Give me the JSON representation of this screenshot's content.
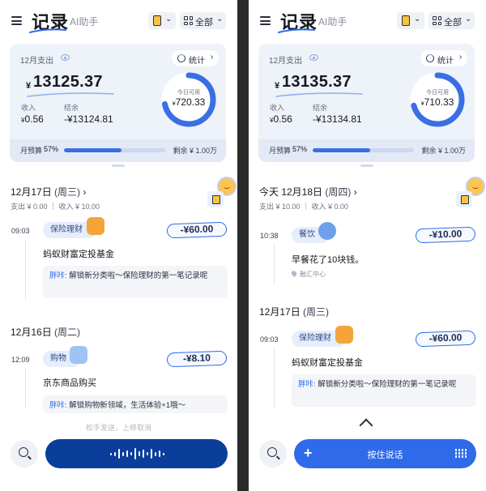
{
  "left": {
    "brand": "记录",
    "assistant": "AI助手",
    "filter_label": "全部",
    "month_label": "12月支出",
    "stats_label": "统计",
    "currency": "¥",
    "total": "13125.37",
    "income_label": "收入",
    "income_value": "0.56",
    "balance_label": "结余",
    "balance_value": "-¥13124.81",
    "ring_label": "今日可用",
    "ring_value": "720.33",
    "ring_progress": 0.72,
    "budget_label": "月预算",
    "budget_pct": "57%",
    "budget_fraction": 0.57,
    "budget_remaining": "剩余 ¥ 1.00万",
    "days": [
      {
        "header": "12月17日",
        "weekday": "(周三)",
        "chevron": "›",
        "sub": "支出 ¥ 0.00 ｜ 收入 ¥ 10.00",
        "entries": [
          {
            "time": "09:03",
            "category": "保险理财",
            "amount": "-¥60.00",
            "title": "蚂蚁财富定投基金",
            "note_who": "胖咔:",
            "note_text": " 解锁新分类啦～保险理财的第一笔记录呢"
          }
        ]
      },
      {
        "header": "12月16日",
        "weekday": "(周二)",
        "entries": [
          {
            "time": "12:09",
            "category": "购物",
            "amount": "-¥8.10",
            "title": "京东商品购买",
            "note_who": "胖咔:",
            "note_text": " 解锁购物新领域，生活体验+1哦～"
          }
        ]
      }
    ],
    "hint": "松手发送，上移取消"
  },
  "right": {
    "brand": "记录",
    "assistant": "AI助手",
    "filter_label": "全部",
    "month_label": "12月支出",
    "stats_label": "统计",
    "currency": "¥",
    "total": "13135.37",
    "income_label": "收入",
    "income_value": "0.56",
    "balance_label": "结余",
    "balance_value": "-¥13134.81",
    "ring_label": "今日可用",
    "ring_value": "710.33",
    "ring_progress": 0.71,
    "budget_label": "月预算",
    "budget_pct": "57%",
    "budget_fraction": 0.57,
    "budget_remaining": "剩余 ¥ 1.00万",
    "days": [
      {
        "header": "今天 12月18日",
        "weekday": "(周四)",
        "chevron": "›",
        "sub": "支出 ¥ 10.00 ｜ 收入 ¥ 0.00",
        "entries": [
          {
            "time": "10:38",
            "category": "餐饮",
            "amount": "-¥10.00",
            "title": "早餐花了10块钱。",
            "location": "融汇中心"
          }
        ]
      },
      {
        "header": "12月17日",
        "weekday": "(周三)",
        "entries": [
          {
            "time": "09:03",
            "category": "保险理财",
            "amount": "-¥60.00",
            "title": "蚂蚁财富定投基金",
            "note_who": "胖咔:",
            "note_text": " 解锁新分类啦～保险理财的第一笔记录呢"
          }
        ]
      }
    ],
    "talk_label": "按住说话"
  },
  "colors": {
    "accent": "#2f6be8",
    "accent_dark": "#0b3e9a",
    "card_bg": "#eef2f9"
  },
  "icons": {
    "menu": "menu-icon",
    "book": "ledger-book-icon",
    "grid": "grid-icon",
    "eye": "eye-icon",
    "stats": "pie-chart-icon",
    "search": "search-icon",
    "keyboard": "keyboard-icon"
  }
}
